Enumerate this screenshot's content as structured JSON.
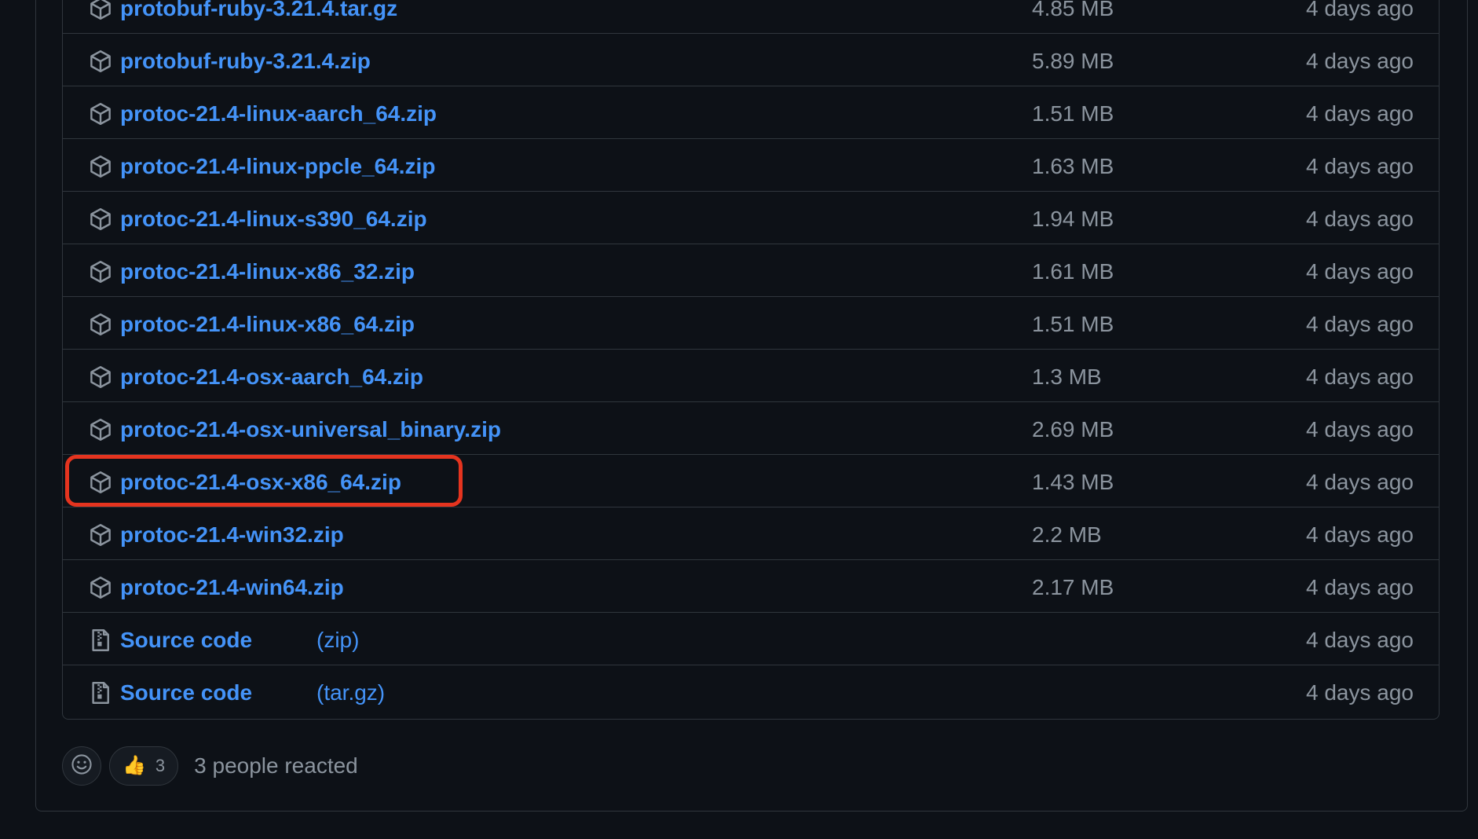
{
  "assets": [
    {
      "name": "protobuf-ruby-3.21.4.tar.gz",
      "size": "4.85 MB",
      "date": "4 days ago",
      "icon": "package-icon"
    },
    {
      "name": "protobuf-ruby-3.21.4.zip",
      "size": "5.89 MB",
      "date": "4 days ago",
      "icon": "package-icon"
    },
    {
      "name": "protoc-21.4-linux-aarch_64.zip",
      "size": "1.51 MB",
      "date": "4 days ago",
      "icon": "package-icon"
    },
    {
      "name": "protoc-21.4-linux-ppcle_64.zip",
      "size": "1.63 MB",
      "date": "4 days ago",
      "icon": "package-icon"
    },
    {
      "name": "protoc-21.4-linux-s390_64.zip",
      "size": "1.94 MB",
      "date": "4 days ago",
      "icon": "package-icon"
    },
    {
      "name": "protoc-21.4-linux-x86_32.zip",
      "size": "1.61 MB",
      "date": "4 days ago",
      "icon": "package-icon"
    },
    {
      "name": "protoc-21.4-linux-x86_64.zip",
      "size": "1.51 MB",
      "date": "4 days ago",
      "icon": "package-icon"
    },
    {
      "name": "protoc-21.4-osx-aarch_64.zip",
      "size": "1.3 MB",
      "date": "4 days ago",
      "icon": "package-icon"
    },
    {
      "name": "protoc-21.4-osx-universal_binary.zip",
      "size": "2.69 MB",
      "date": "4 days ago",
      "icon": "package-icon"
    },
    {
      "name": "protoc-21.4-osx-x86_64.zip",
      "size": "1.43 MB",
      "date": "4 days ago",
      "icon": "package-icon",
      "highlighted": true
    },
    {
      "name": "protoc-21.4-win32.zip",
      "size": "2.2 MB",
      "date": "4 days ago",
      "icon": "package-icon"
    },
    {
      "name": "protoc-21.4-win64.zip",
      "size": "2.17 MB",
      "date": "4 days ago",
      "icon": "package-icon"
    },
    {
      "name": "Source code",
      "format": "(zip)",
      "size": "",
      "date": "4 days ago",
      "icon": "file-zip-icon"
    },
    {
      "name": "Source code",
      "format": "(tar.gz)",
      "size": "",
      "date": "4 days ago",
      "icon": "file-zip-icon"
    }
  ],
  "reactions": {
    "emoji": "👍",
    "count": "3",
    "summary": "3 people reacted"
  },
  "colors": {
    "background": "#0d1117",
    "border": "#30363d",
    "link": "#4493f8",
    "muted": "#8b949e",
    "highlight": "#e5341f"
  }
}
